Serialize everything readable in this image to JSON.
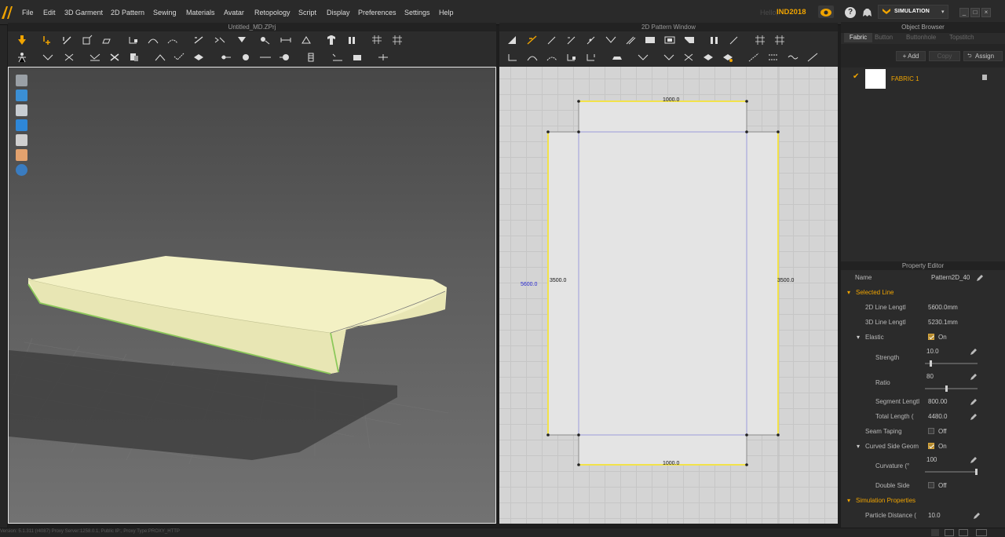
{
  "menu": [
    "File",
    "Edit",
    "3D Garment",
    "2D Pattern",
    "Sewing",
    "Materials",
    "Avatar",
    "Retopology",
    "Script",
    "Display",
    "Preferences",
    "Settings",
    "Help"
  ],
  "header": {
    "hello": "Hello,",
    "user": "IND2018",
    "mode": "SIMULATION"
  },
  "window_controls": [
    "_",
    "□",
    "×"
  ],
  "panels": {
    "left_title": "Untitled_MD.ZPrj",
    "middle_title": "2D Pattern Window"
  },
  "pattern_labels": {
    "top": "1000.0",
    "bottom": "1000.0",
    "left_outer": "5600.0",
    "left_inner": "3500.0",
    "right_inner": "3500.0"
  },
  "object_browser": {
    "title": "Object Browser",
    "tabs": [
      "Fabric",
      "Button",
      "Buttonhole",
      "Topstitch"
    ],
    "add_label": "+ Add",
    "copy_label": "Copy",
    "assign_label": "Assign",
    "fabric_name": "FABRIC 1"
  },
  "property_editor": {
    "title": "Property Editor",
    "name_label": "Name",
    "name_value": "Pattern2D_40",
    "selected_line": "Selected Line",
    "line_2d_label": "2D Line Lengtl",
    "line_2d_value": "5600.0mm",
    "line_3d_label": "3D Line Lengtl",
    "line_3d_value": "5230.1mm",
    "elastic_label": "Elastic",
    "elastic_value": "On",
    "strength_label": "Strength",
    "strength_value": "10.0",
    "strength_level": 0.1,
    "ratio_label": "Ratio",
    "ratio_value": "80",
    "ratio_level": 0.4,
    "segment_label": "Segment Lengtl",
    "segment_value": "800.00",
    "total_label": "Total Length (",
    "total_value": "4480.0",
    "seam_taping_label": "Seam Taping",
    "seam_taping_value": "Off",
    "curved_label": "Curved Side Geom",
    "curved_value": "On",
    "curvature_label": "Curvature (°",
    "curvature_value": "100",
    "curvature_level": 1.0,
    "double_side_label": "Double Side",
    "double_side_value": "Off",
    "sim_props": "Simulation Properties",
    "particle_label": "Particle Distance (",
    "particle_value": "10.0"
  },
  "status_text": "Version: 5.1.311 (r4087)  Proxy Server:1258.0.1, Public IP:, Proxy Type:PROXY_HTTP",
  "colors": {
    "accent": "#f0a400",
    "garment": "#f3f1c4",
    "selected_line": "#f2e24a",
    "internal_line": "#8a8ad8"
  }
}
